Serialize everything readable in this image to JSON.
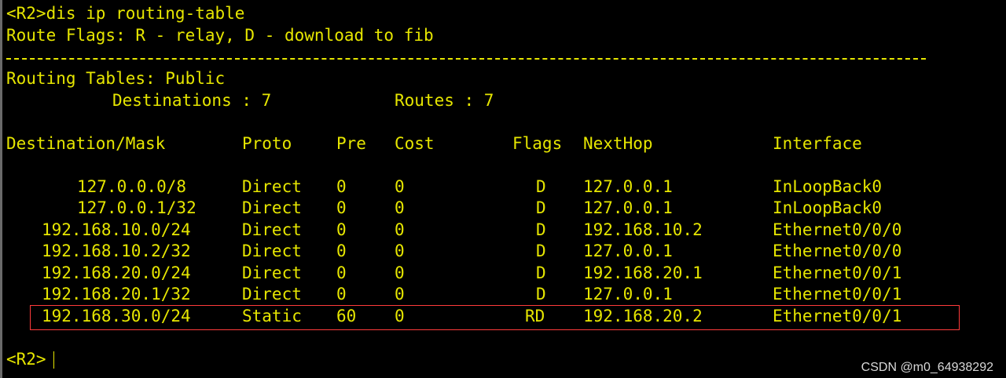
{
  "terminal": {
    "command_line": "<R2>dis ip routing-table",
    "flags_legend": "Route Flags: R - relay, D - download to fib",
    "tables_title": "Routing Tables: Public",
    "destinations_label": "Destinations : 7",
    "routes_label": "Routes : 7",
    "headers": {
      "destination": "Destination/Mask",
      "proto": "Proto",
      "pre": "Pre",
      "cost": "Cost",
      "flags": "Flags",
      "nexthop": "NextHop",
      "interface": "Interface"
    },
    "routes": [
      {
        "destination": "127.0.0.0/8",
        "proto": "Direct",
        "pre": "0",
        "cost": "0",
        "flags": "D",
        "nexthop": "127.0.0.1",
        "interface": "InLoopBack0"
      },
      {
        "destination": "127.0.0.1/32",
        "proto": "Direct",
        "pre": "0",
        "cost": "0",
        "flags": "D",
        "nexthop": "127.0.0.1",
        "interface": "InLoopBack0"
      },
      {
        "destination": "192.168.10.0/24",
        "proto": "Direct",
        "pre": "0",
        "cost": "0",
        "flags": "D",
        "nexthop": "192.168.10.2",
        "interface": "Ethernet0/0/0"
      },
      {
        "destination": "192.168.10.2/32",
        "proto": "Direct",
        "pre": "0",
        "cost": "0",
        "flags": "D",
        "nexthop": "127.0.0.1",
        "interface": "Ethernet0/0/0"
      },
      {
        "destination": "192.168.20.0/24",
        "proto": "Direct",
        "pre": "0",
        "cost": "0",
        "flags": "D",
        "nexthop": "192.168.20.1",
        "interface": "Ethernet0/0/1"
      },
      {
        "destination": "192.168.20.1/32",
        "proto": "Direct",
        "pre": "0",
        "cost": "0",
        "flags": "D",
        "nexthop": "127.0.0.1",
        "interface": "Ethernet0/0/1"
      },
      {
        "destination": "192.168.30.0/24",
        "proto": "Static",
        "pre": "60",
        "cost": "0",
        "flags": "RD",
        "nexthop": "192.168.20.2",
        "interface": "Ethernet0/0/1"
      }
    ],
    "prompt": "<R2>"
  },
  "watermark": "CSDN @m0_64938292",
  "colors": {
    "background": "#000000",
    "text": "#e6e600",
    "highlight": "#ff3b3b"
  }
}
